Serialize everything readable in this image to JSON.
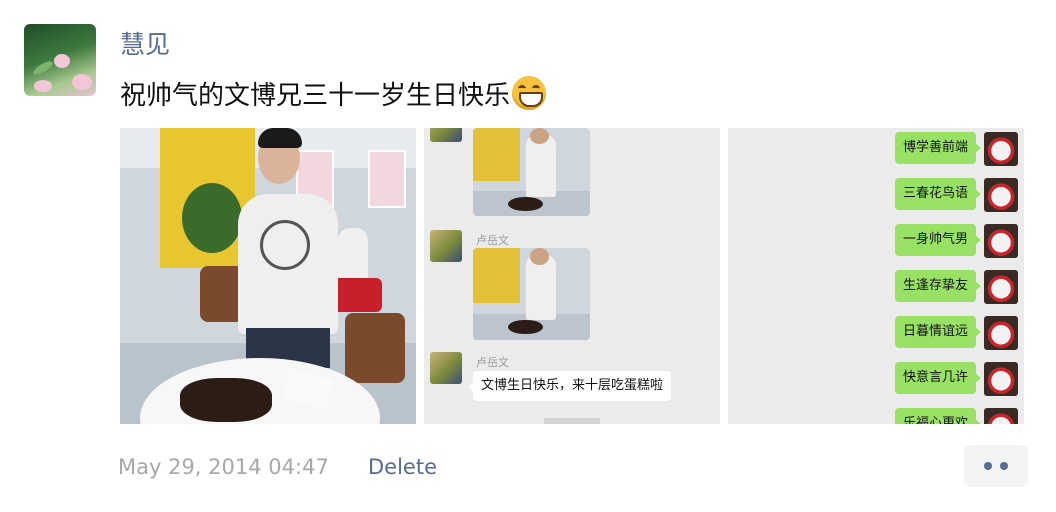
{
  "post": {
    "username": "慧见",
    "text": "祝帅气的文博兄三十一岁生日快乐",
    "emoji_icon": "grinning-face-emoji",
    "timestamp": "May 29, 2014 04:47",
    "delete_label": "Delete",
    "more_icon": "more-dots-icon"
  },
  "chat_screenshot": {
    "messages": [
      {
        "sender": "卢岳文"
      },
      {
        "sender": "卢岳文",
        "text": "文博生日快乐，来十层吃蛋糕啦"
      }
    ]
  },
  "poem_chat": {
    "lines": [
      "博学善前端",
      "三春花鸟语",
      "一身帅气男",
      "生逢存挚友",
      "日暮情谊远",
      "快意言几许",
      "乐福心更欢"
    ]
  },
  "colors": {
    "link": "#576b95",
    "timestamp": "#a8a8a8",
    "green_bubble": "#98e165"
  }
}
